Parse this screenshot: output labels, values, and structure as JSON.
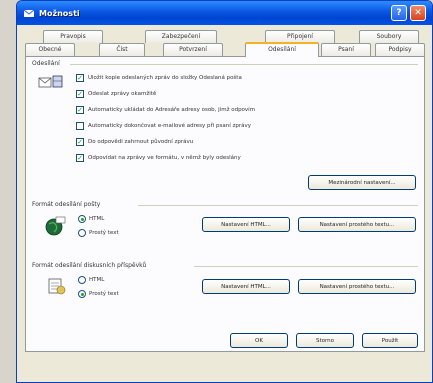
{
  "window": {
    "title": "Možnosti"
  },
  "tabs": {
    "row1": [
      "Pravopis",
      "Zabezpečení",
      "Připojení",
      "Soubory"
    ],
    "row2": [
      "Obecné",
      "Číst",
      "Potvrzení",
      "Odesílání",
      "Psaní",
      "Podpisy"
    ],
    "active": "Odesílání"
  },
  "sending": {
    "label": "Odesílání",
    "options": [
      {
        "label": "Uložit kopie odeslaných zpráv do složky Odeslaná pošta",
        "checked": true
      },
      {
        "label": "Odeslat zprávy okamžitě",
        "checked": true
      },
      {
        "label": "Automaticky ukládat do Adresáře adresy osob, jimž odpovím",
        "checked": true
      },
      {
        "label": "Automaticky dokončovat e-mailové adresy při psaní zprávy",
        "checked": false
      },
      {
        "label": "Do odpovědi zahrnout původní zprávu",
        "checked": true
      },
      {
        "label": "Odpovídat na zprávy ve formátu, v němž byly odeslány",
        "checked": true
      }
    ],
    "intl_button": "Mezinárodní nastavení..."
  },
  "mail_format": {
    "label": "Formát odesílání pošty",
    "options": [
      {
        "label": "HTML",
        "selected": true
      },
      {
        "label": "Prostý text",
        "selected": false
      }
    ],
    "html_settings_button": "Nastavení HTML...",
    "plain_settings_button": "Nastavení prostého textu..."
  },
  "news_format": {
    "label": "Formát odesílání diskusních příspěvků",
    "options": [
      {
        "label": "HTML",
        "selected": false
      },
      {
        "label": "Prostý text",
        "selected": true
      }
    ],
    "html_settings_button": "Nastavení HTML...",
    "plain_settings_button": "Nastavení prostého textu..."
  },
  "footer": {
    "ok": "OK",
    "cancel": "Storno",
    "apply": "Použít"
  },
  "colors": {
    "titlebar": "#0a56e3",
    "active_tab_accent": "#f6b12a",
    "check": "#21a121"
  }
}
